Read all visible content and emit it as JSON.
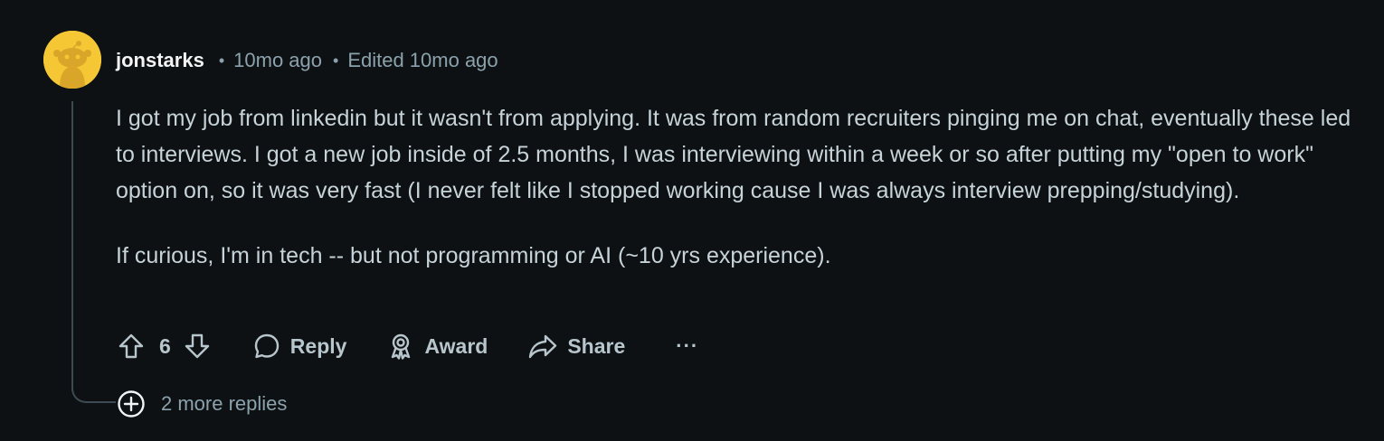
{
  "comment": {
    "username": "jonstarks",
    "time": "10mo ago",
    "edited": "Edited 10mo ago",
    "paragraphs": [
      "I got my job from linkedin but it wasn't from applying. It was from random recruiters pinging me on chat, eventually these led to interviews. I got a new job inside of 2.5 months, I was interviewing within a week or so after putting my \"open to work\" option on, so it was very fast (I never felt like I stopped working cause I was always interview prepping/studying).",
      "If curious, I'm in tech -- but not programming or AI (~10 yrs experience)."
    ],
    "separator": "•"
  },
  "actions": {
    "score": "6",
    "reply_label": "Reply",
    "award_label": "Award",
    "share_label": "Share",
    "more_label": "···"
  },
  "replies": {
    "more_label": "2 more replies"
  },
  "icons": {
    "avatar": "snoo-avatar-icon",
    "upvote": "upvote-arrow-icon",
    "downvote": "downvote-arrow-icon",
    "reply": "speech-bubble-icon",
    "award": "award-ribbon-icon",
    "share": "share-arrow-icon",
    "expand": "plus-circle-icon"
  },
  "colors": {
    "background": "#0e1113",
    "avatar_bg": "#f5c734",
    "username": "#f2f4f5",
    "meta": "#8ba2ad",
    "body_text": "#c6d3d9"
  }
}
